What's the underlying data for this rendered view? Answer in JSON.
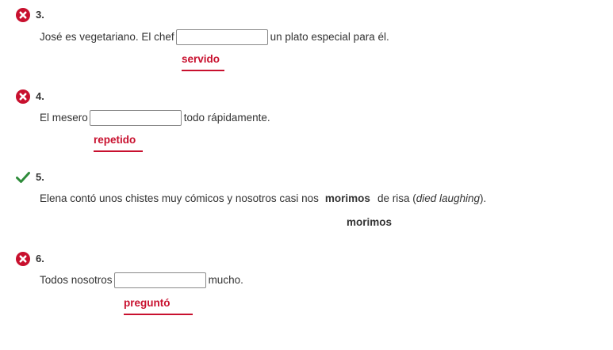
{
  "colors": {
    "incorrect": "#c8102e",
    "correct": "#2e8b3a",
    "text": "#333333"
  },
  "questions": [
    {
      "number": "3.",
      "status": "incorrect",
      "icon": "x-circle-icon",
      "before": "José es vegetariano. El chef",
      "input_value": "",
      "after": "un plato especial para él.",
      "answer": "servido"
    },
    {
      "number": "4.",
      "status": "incorrect",
      "icon": "x-circle-icon",
      "before": "El mesero",
      "input_value": "",
      "after": "todo rápidamente.",
      "answer": "repetido"
    },
    {
      "number": "5.",
      "status": "correct",
      "icon": "checkmark-icon",
      "before": "Elena contó unos chistes muy cómicos y nosotros casi nos",
      "filled_value": "morimos",
      "after_plain": "de risa (",
      "after_italic": "died laughing",
      "after_end": ").",
      "answer": "morimos"
    },
    {
      "number": "6.",
      "status": "incorrect",
      "icon": "x-circle-icon",
      "before": "Todos nosotros",
      "input_value": "",
      "after": "mucho.",
      "answer": "preguntó"
    }
  ]
}
